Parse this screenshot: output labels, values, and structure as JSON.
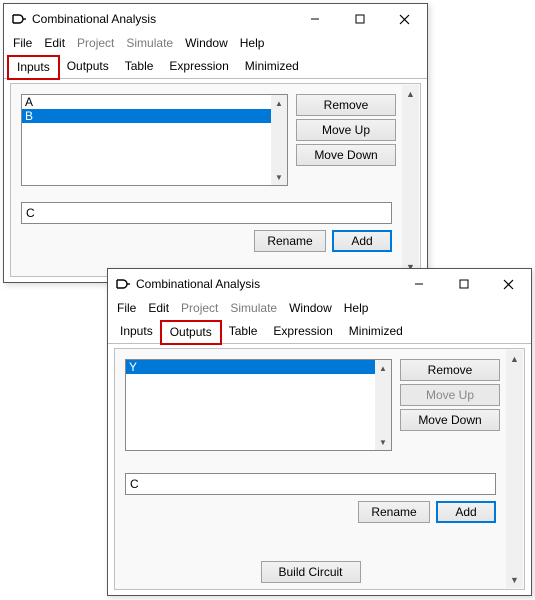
{
  "window1": {
    "title": "Combinational Analysis",
    "menu": {
      "file": "File",
      "edit": "Edit",
      "project": "Project",
      "simulate": "Simulate",
      "window": "Window",
      "help": "Help"
    },
    "tabs": {
      "inputs": "Inputs",
      "outputs": "Outputs",
      "table": "Table",
      "expression": "Expression",
      "minimized": "Minimized"
    },
    "list": {
      "item0": "A",
      "item1": "B"
    },
    "buttons": {
      "remove": "Remove",
      "moveup": "Move Up",
      "movedown": "Move Down",
      "rename": "Rename",
      "add": "Add"
    },
    "input_value": "C"
  },
  "window2": {
    "title": "Combinational Analysis",
    "menu": {
      "file": "File",
      "edit": "Edit",
      "project": "Project",
      "simulate": "Simulate",
      "window": "Window",
      "help": "Help"
    },
    "tabs": {
      "inputs": "Inputs",
      "outputs": "Outputs",
      "table": "Table",
      "expression": "Expression",
      "minimized": "Minimized"
    },
    "list": {
      "item0": "Y"
    },
    "buttons": {
      "remove": "Remove",
      "moveup": "Move Up",
      "movedown": "Move Down",
      "rename": "Rename",
      "add": "Add",
      "build": "Build Circuit"
    },
    "input_value": "C"
  }
}
